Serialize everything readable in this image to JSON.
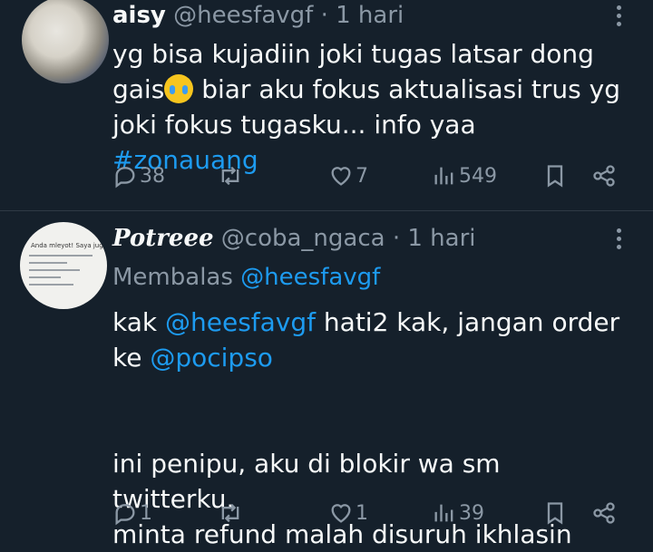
{
  "tweets": [
    {
      "name": "aisy",
      "handle": "@heesfavgf",
      "time": "1 hari",
      "lines": [
        "yg bisa kujadiin joki tugas latsar dong",
        "gais",
        " biar aku fokus aktualisasi trus yg",
        "joki fokus tugasku... info yaa ",
        "#zonauang"
      ],
      "emoji": "loudly-crying-face",
      "actions": {
        "replies": "38",
        "retweets": "",
        "likes": "7",
        "views": "549"
      }
    },
    {
      "name": "Potreee",
      "handle": "@coba_ngaca",
      "time": "1 hari",
      "replying_label": "Membalas",
      "replying_to": "@heesfavgf",
      "body": {
        "p1_a": "kak ",
        "p1_mention": "@heesfavgf",
        "p1_b": " hati2 kak, jangan order",
        "p1_c": "ke ",
        "p1_mention2": "@pocipso",
        "p2_line1": "ini penipu, aku di blokir wa sm twitterku.",
        "p2_line2": "minta refund malah disuruh ikhlasin"
      },
      "avatar_text": "Anda mleyot! Saya juga",
      "actions": {
        "replies": "1",
        "retweets": "",
        "likes": "1",
        "views": "39"
      }
    }
  ],
  "separator": "·",
  "colors": {
    "background": "#15202b",
    "text": "#f7f9f9",
    "muted": "#8b98a5",
    "link": "#1d9bf0"
  }
}
